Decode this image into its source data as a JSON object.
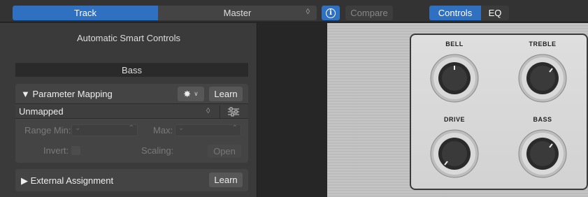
{
  "topbar": {
    "track_tab": "Track",
    "master_tab": "Master",
    "updown_glyph": "◊",
    "info_icon": "i",
    "compare": "Compare",
    "controls_tab": "Controls",
    "eq_tab": "EQ"
  },
  "smart_controls": {
    "title": "Automatic Smart Controls",
    "section": "Bass",
    "parameter_mapping": {
      "title": "Parameter Mapping",
      "learn": "Learn",
      "mapping_value": "Unmapped",
      "range_min_label": "Range Min:",
      "max_label": "Max:",
      "invert_label": "Invert:",
      "scaling_label": "Scaling:",
      "open": "Open"
    },
    "external_assignment": {
      "title": "External Assignment",
      "learn": "Learn"
    }
  },
  "plugin": {
    "knobs": [
      {
        "label": "BELL"
      },
      {
        "label": "TREBLE"
      },
      {
        "label": "DRIVE"
      },
      {
        "label": "BASS"
      }
    ]
  },
  "colors": {
    "accent": "#2f70c0"
  }
}
